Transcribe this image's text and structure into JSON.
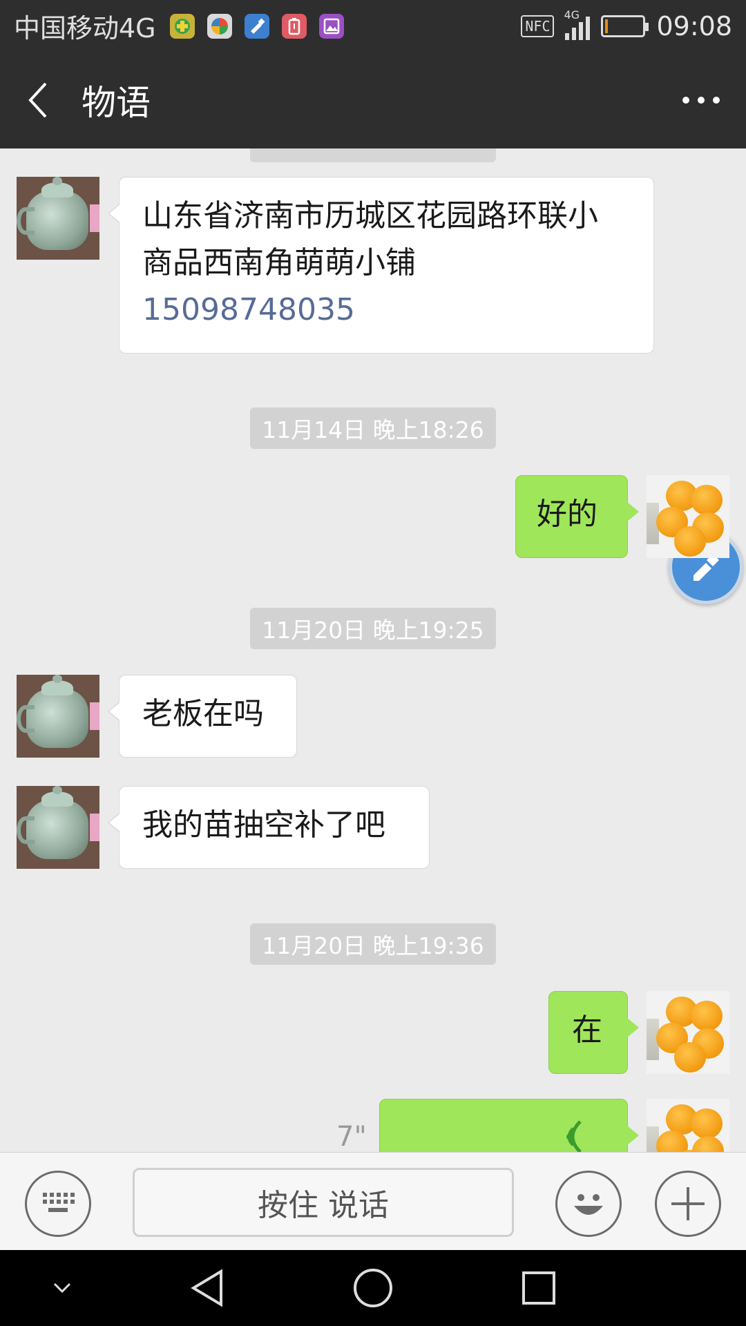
{
  "status_bar": {
    "carrier": "中国移动4G",
    "network": "4G",
    "nfc": "NFC",
    "time": "09:08",
    "app_icons": [
      "green-app-icon",
      "color-wheel-app-icon",
      "blue-brush-app-icon",
      "red-battery-app-icon",
      "purple-gallery-app-icon"
    ]
  },
  "header": {
    "title": "物语"
  },
  "messages": [
    {
      "direction": "in",
      "lines": [
        "山东省济南市历城区花园路环联小",
        "商品西南角萌萌小铺"
      ],
      "phone": "15098748035"
    },
    {
      "type": "time",
      "text": "11月14日 晚上18:26"
    },
    {
      "direction": "out",
      "text": "好的"
    },
    {
      "type": "time",
      "text": "11月20日 晚上19:25"
    },
    {
      "direction": "in",
      "text": "老板在吗"
    },
    {
      "direction": "in",
      "text": "我的苗抽空补了吧"
    },
    {
      "type": "time",
      "text": "11月20日 晚上19:36"
    },
    {
      "direction": "out",
      "text": "在"
    },
    {
      "direction": "out",
      "type": "voice",
      "duration": "7\""
    }
  ],
  "input": {
    "hold_to_talk": "按住 说话"
  },
  "colors": {
    "header_bg": "#2e2e2e",
    "chat_bg": "#ebebeb",
    "out_bubble": "#9fe65a",
    "in_bubble": "#ffffff",
    "link": "#576b95",
    "timestamp_bg": "#d2d2d2"
  }
}
